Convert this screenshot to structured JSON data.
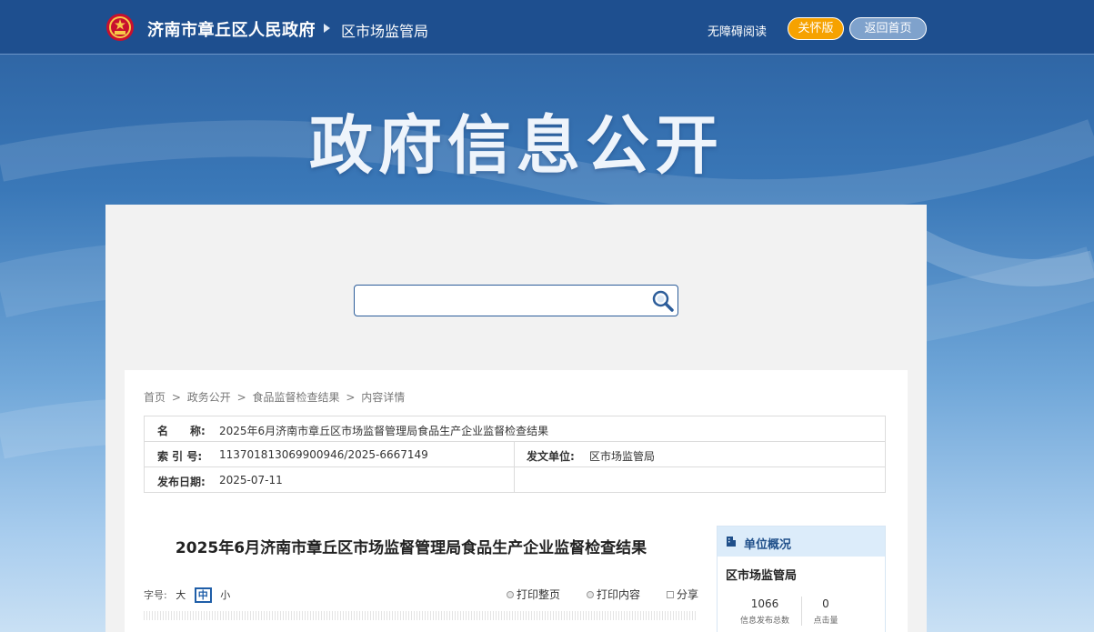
{
  "header": {
    "site_name": "济南市章丘区人民政府",
    "dept_name": "区市场监管局",
    "accessibility_label": "无障碍阅读",
    "care_mode_label": "关怀版",
    "home_label": "返回首页"
  },
  "banner": {
    "title": "政府信息公开"
  },
  "search": {
    "placeholder": ""
  },
  "breadcrumb": [
    "首页",
    ">",
    "政务公开",
    ">",
    "食品监督检查结果",
    ">",
    "内容详情"
  ],
  "info": {
    "name_label": "名　　称:",
    "name_value": "2025年6月济南市章丘区市场监督管理局食品生产企业监督检查结果",
    "index_label": "索 引 号:",
    "index_value": "113701813069900946/2025-6667149",
    "issuer_label": "发文单位:",
    "issuer_value": "区市场监管局",
    "date_label": "发布日期:",
    "date_value": "2025-07-11"
  },
  "article": {
    "title": "2025年6月济南市章丘区市场监督管理局食品生产企业监督检查结果",
    "font_size_label": "字号:",
    "font_sizes": [
      "大",
      "中",
      "小"
    ],
    "print_page_label": "打印整页",
    "print_content_label": "打印内容",
    "share_label": "分享"
  },
  "sidebar": {
    "heading": "单位概况",
    "unit_name": "区市场监管局",
    "stats": [
      {
        "value": "1066",
        "label": "信息发布总数"
      },
      {
        "value": "0",
        "label": "点击量"
      }
    ]
  },
  "colors": {
    "header_bg": "#1e4f8f",
    "care_btn": "#f6a200",
    "accent": "#1f5ea8"
  }
}
